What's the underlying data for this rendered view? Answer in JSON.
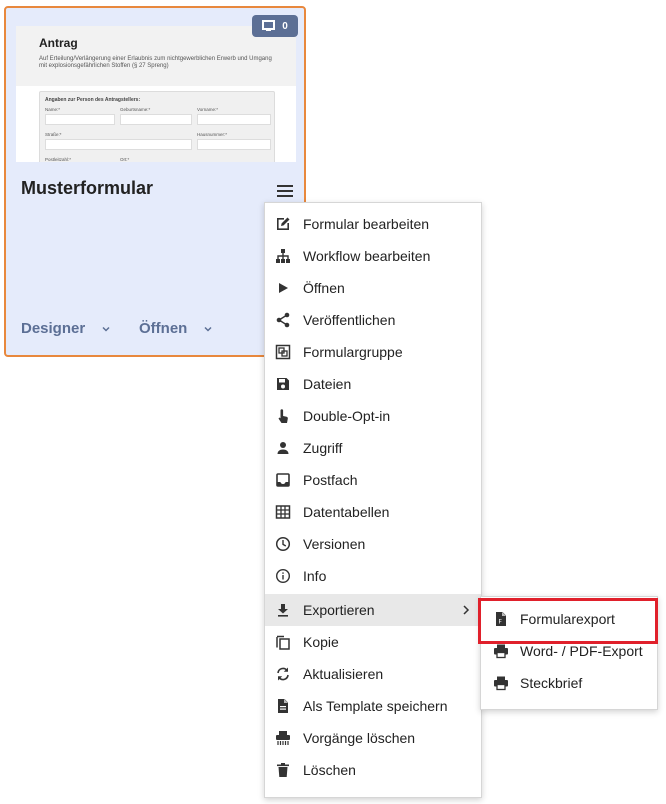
{
  "card": {
    "preview": {
      "title": "Antrag",
      "subtitle": "Auf Erteilung/Verlängerung einer Erlaubnis zum nichtgewerblichen Erwerb und Umgang mit explosionsgefährlichen Stoffen (§ 27 Spreng)",
      "section_heading": "Angaben zur Person des Antragstellers:",
      "field_labels": [
        "Name:*",
        "Geburtsname:*",
        "Vorname:*",
        "Straße:*",
        "Hausnummer:*",
        "Postleitzahl:*",
        "Ort:*"
      ]
    },
    "badge_count": "0",
    "title": "Musterformular",
    "actions": {
      "designer": "Designer",
      "open": "Öffnen"
    }
  },
  "menu": {
    "items": [
      {
        "label": "Formular bearbeiten",
        "icon": "edit-icon"
      },
      {
        "label": "Workflow bearbeiten",
        "icon": "workflow-icon"
      },
      {
        "label": "Öffnen",
        "icon": "play-icon"
      },
      {
        "label": "Veröffentlichen",
        "icon": "share-icon"
      },
      {
        "label": "Formulargruppe",
        "icon": "group-icon"
      },
      {
        "label": "Dateien",
        "icon": "save-icon"
      },
      {
        "label": "Double-Opt-in",
        "icon": "touch-icon"
      },
      {
        "label": "Zugriff",
        "icon": "person-icon"
      },
      {
        "label": "Postfach",
        "icon": "inbox-icon"
      },
      {
        "label": "Datentabellen",
        "icon": "table-icon"
      },
      {
        "label": "Versionen",
        "icon": "clock-icon"
      },
      {
        "label": "Info",
        "icon": "info-icon"
      },
      {
        "label": "Exportieren",
        "icon": "download-icon"
      },
      {
        "label": "Kopie",
        "icon": "copy-icon"
      },
      {
        "label": "Aktualisieren",
        "icon": "refresh-icon"
      },
      {
        "label": "Als Template speichern",
        "icon": "file-icon"
      },
      {
        "label": "Vorgänge löschen",
        "icon": "shredder-icon"
      },
      {
        "label": "Löschen",
        "icon": "trash-icon"
      }
    ]
  },
  "submenu": {
    "items": [
      {
        "label": "Formularexport",
        "icon": "file-export-icon"
      },
      {
        "label": "Word- / PDF-Export",
        "icon": "print-icon"
      },
      {
        "label": "Steckbrief",
        "icon": "print-icon"
      }
    ]
  },
  "colors": {
    "card_border": "#e8883d",
    "card_bg": "#e5ebfb",
    "accent": "#5c6f95",
    "highlight": "#e0202b"
  }
}
